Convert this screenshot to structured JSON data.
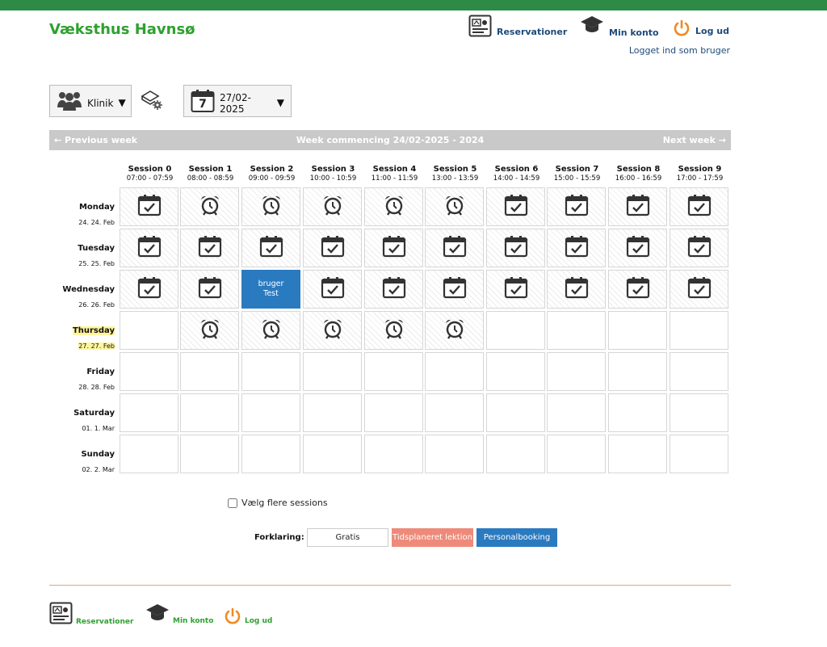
{
  "app": {
    "title": "Væksthus Havnsø"
  },
  "header": {
    "nav": [
      {
        "label": "Reservationer",
        "icon": "reservations-icon"
      },
      {
        "label": "Min konto",
        "icon": "graduation-cap-icon"
      },
      {
        "label": "Log ud",
        "icon": "power-icon"
      }
    ],
    "logged_in": "Logget ind som bruger"
  },
  "controls": {
    "location": "Klinik",
    "date": "27/02-2025",
    "calendar_day": "7"
  },
  "week_nav": {
    "prev": "← Previous week",
    "title": "Week commencing 24/02-2025 - 2024",
    "next": "Next week →"
  },
  "sessions": [
    {
      "name": "Session 0",
      "time": "07:00 - 07:59"
    },
    {
      "name": "Session 1",
      "time": "08:00 - 08:59"
    },
    {
      "name": "Session 2",
      "time": "09:00 - 09:59"
    },
    {
      "name": "Session 3",
      "time": "10:00 - 10:59"
    },
    {
      "name": "Session 4",
      "time": "11:00 - 11:59"
    },
    {
      "name": "Session 5",
      "time": "13:00 - 13:59"
    },
    {
      "name": "Session 6",
      "time": "14:00 - 14:59"
    },
    {
      "name": "Session 7",
      "time": "15:00 - 15:59"
    },
    {
      "name": "Session 8",
      "time": "16:00 - 16:59"
    },
    {
      "name": "Session 9",
      "time": "17:00 - 17:59"
    }
  ],
  "days": [
    {
      "name": "Monday",
      "date": "24. 24. Feb",
      "today": false,
      "cells": [
        "calendar-check",
        "alarm",
        "alarm",
        "alarm",
        "alarm",
        "alarm",
        "calendar-check",
        "calendar-check",
        "calendar-check",
        "calendar-check"
      ]
    },
    {
      "name": "Tuesday",
      "date": "25. 25. Feb",
      "today": false,
      "cells": [
        "calendar-check",
        "calendar-check",
        "calendar-check",
        "calendar-check",
        "calendar-check",
        "calendar-check",
        "calendar-check",
        "calendar-check",
        "calendar-check",
        "calendar-check"
      ]
    },
    {
      "name": "Wednesday",
      "date": "26. 26. Feb",
      "today": false,
      "cells": [
        "calendar-check",
        "calendar-check",
        "booked",
        "calendar-check",
        "calendar-check",
        "calendar-check",
        "calendar-check",
        "calendar-check",
        "calendar-check",
        "calendar-check"
      ]
    },
    {
      "name": "Thursday",
      "date": "27. 27. Feb",
      "today": true,
      "cells": [
        "empty",
        "alarm",
        "alarm",
        "alarm",
        "alarm",
        "alarm",
        "empty",
        "empty",
        "empty",
        "empty"
      ]
    },
    {
      "name": "Friday",
      "date": "28. 28. Feb",
      "today": false,
      "cells": [
        "empty",
        "empty",
        "empty",
        "empty",
        "empty",
        "empty",
        "empty",
        "empty",
        "empty",
        "empty"
      ]
    },
    {
      "name": "Saturday",
      "date": "01. 1. Mar",
      "today": false,
      "cells": [
        "empty",
        "empty",
        "empty",
        "empty",
        "empty",
        "empty",
        "empty",
        "empty",
        "empty",
        "empty"
      ]
    },
    {
      "name": "Sunday",
      "date": "02. 2. Mar",
      "today": false,
      "cells": [
        "empty",
        "empty",
        "empty",
        "empty",
        "empty",
        "empty",
        "empty",
        "empty",
        "empty",
        "empty"
      ]
    }
  ],
  "booking": {
    "line1": "bruger",
    "line2": "Test"
  },
  "multi_select": {
    "label": "Vælg flere sessions"
  },
  "legend": {
    "label": "Forklaring:",
    "items": [
      {
        "label": "Gratis",
        "bg": "#ffffff",
        "fg": "#222222"
      },
      {
        "label": "Tidsplaneret lektion",
        "bg": "#ee8a7a",
        "fg": "#ffffff"
      },
      {
        "label": "Personalbooking",
        "bg": "#2a7ac0",
        "fg": "#ffffff"
      }
    ]
  },
  "footer": {
    "nav": [
      {
        "label": "Reservationer"
      },
      {
        "label": "Min konto"
      },
      {
        "label": "Log ud"
      }
    ]
  },
  "colors": {
    "brand_green": "#2ea12e",
    "topbar": "#2e8b47",
    "link_blue": "#1d4a7a",
    "accent_orange": "#f08a24"
  }
}
